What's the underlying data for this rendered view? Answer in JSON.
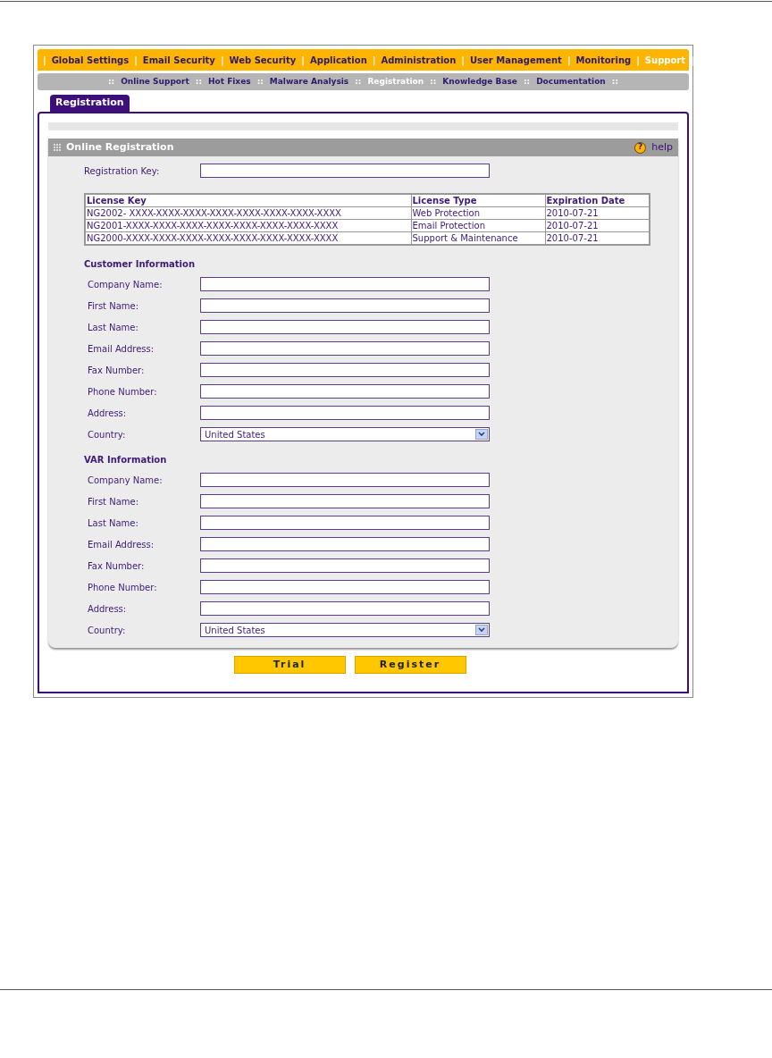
{
  "nav": {
    "separator": "|",
    "items": [
      {
        "label": "Global Settings",
        "selected": false
      },
      {
        "label": "Email Security",
        "selected": false
      },
      {
        "label": "Web Security",
        "selected": false
      },
      {
        "label": "Application",
        "selected": false
      },
      {
        "label": "Administration",
        "selected": false
      },
      {
        "label": "User Management",
        "selected": false
      },
      {
        "label": "Monitoring",
        "selected": false
      },
      {
        "label": "Support",
        "selected": true
      }
    ]
  },
  "subnav": {
    "separator": "::",
    "items": [
      {
        "label": "Online Support",
        "selected": false
      },
      {
        "label": "Hot Fixes",
        "selected": false
      },
      {
        "label": "Malware Analysis",
        "selected": false
      },
      {
        "label": "Registration",
        "selected": true
      },
      {
        "label": "Knowledge Base",
        "selected": false
      },
      {
        "label": "Documentation",
        "selected": false
      }
    ]
  },
  "tabs": [
    {
      "label": "Registration",
      "selected": true
    }
  ],
  "section": {
    "title": "Online Registration",
    "help_icon": "?",
    "help": "help"
  },
  "registration_key": {
    "label": "Registration Key:"
  },
  "license_table": {
    "columns": [
      "License Key",
      "License Type",
      "Expiration Date"
    ],
    "rows": [
      [
        "NG2002- XXXX-XXXX-XXXX-XXXX-XXXX-XXXX-XXXX-XXXX",
        "Web Protection",
        "2010-07-21"
      ],
      [
        "NG2001-XXXX-XXXX-XXXX-XXXX-XXXX-XXXX-XXXX-XXXX",
        "Email Protection",
        "2010-07-21"
      ],
      [
        "NG2000-XXXX-XXXX-XXXX-XXXX-XXXX-XXXX-XXXX-XXXX",
        "Support & Maintenance",
        "2010-07-21"
      ]
    ]
  },
  "groups": [
    {
      "heading": "Customer Information",
      "fields": [
        {
          "kind": "text",
          "label": "Company Name:"
        },
        {
          "kind": "text",
          "label": "First Name:"
        },
        {
          "kind": "text",
          "label": "Last Name:"
        },
        {
          "kind": "text",
          "label": "Email Address:"
        },
        {
          "kind": "text",
          "label": "Fax Number:"
        },
        {
          "kind": "text",
          "label": "Phone Number:"
        },
        {
          "kind": "text",
          "label": "Address:"
        },
        {
          "kind": "select",
          "label": "Country:",
          "value": "United States"
        }
      ]
    },
    {
      "heading": "VAR Information",
      "fields": [
        {
          "kind": "text",
          "label": "Company Name:"
        },
        {
          "kind": "text",
          "label": "First Name:"
        },
        {
          "kind": "text",
          "label": "Last Name:"
        },
        {
          "kind": "text",
          "label": "Email Address:"
        },
        {
          "kind": "text",
          "label": "Fax Number:"
        },
        {
          "kind": "text",
          "label": "Phone Number:"
        },
        {
          "kind": "text",
          "label": "Address:"
        },
        {
          "kind": "select",
          "label": "Country:",
          "value": "United States"
        }
      ]
    }
  ],
  "buttons": [
    "Trial",
    "Register"
  ]
}
